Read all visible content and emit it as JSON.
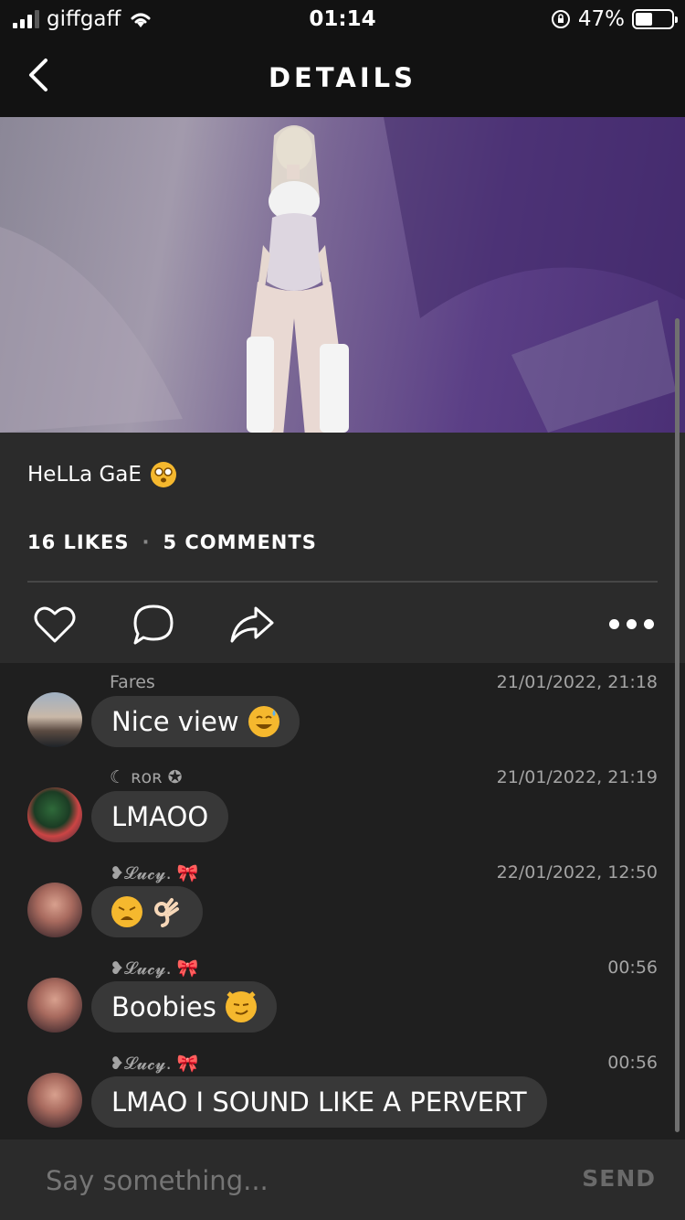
{
  "status_bar": {
    "carrier": "giffgaff",
    "time": "01:14",
    "battery": "47%"
  },
  "nav": {
    "title": "DETAILS",
    "back_icon": "chevron-left-icon"
  },
  "post": {
    "image_alt": "avatar photo",
    "caption": "HeLLa GaE",
    "caption_emoji": "dizzy-face-emoji",
    "likes": "16 LIKES",
    "separator": "·",
    "comments": "5 COMMENTS",
    "actions": [
      "heart-icon",
      "comment-icon",
      "share-icon",
      "more-icon"
    ]
  },
  "comments": [
    {
      "author": "Fares",
      "time": "21/01/2022, 21:18",
      "text": "Nice view",
      "emoji": "sweat-smile-emoji"
    },
    {
      "author": "☾ ʀᴏʀ ✪",
      "time": "21/01/2022, 21:19",
      "text": "LMAOO",
      "emoji": ""
    },
    {
      "author": "❥𝓛𝓾𝓬𝔂. 🎀",
      "time": "22/01/2022, 12:50",
      "text": "",
      "emoji": "weary-face-ok-hand-emoji"
    },
    {
      "author": "❥𝓛𝓾𝓬𝔂. 🎀",
      "time": "00:56",
      "text": "Boobies",
      "emoji": "smirk-cat-emoji"
    },
    {
      "author": "❥𝓛𝓾𝓬𝔂. 🎀",
      "time": "00:56",
      "text": "LMAO I SOUND LIKE A PERVERT",
      "emoji": ""
    }
  ],
  "input": {
    "placeholder": "Say something...",
    "send_label": "SEND"
  },
  "colors": {
    "background": "#1c1c1c",
    "bubble": "#383838",
    "muted_text": "#a4a4a4"
  }
}
